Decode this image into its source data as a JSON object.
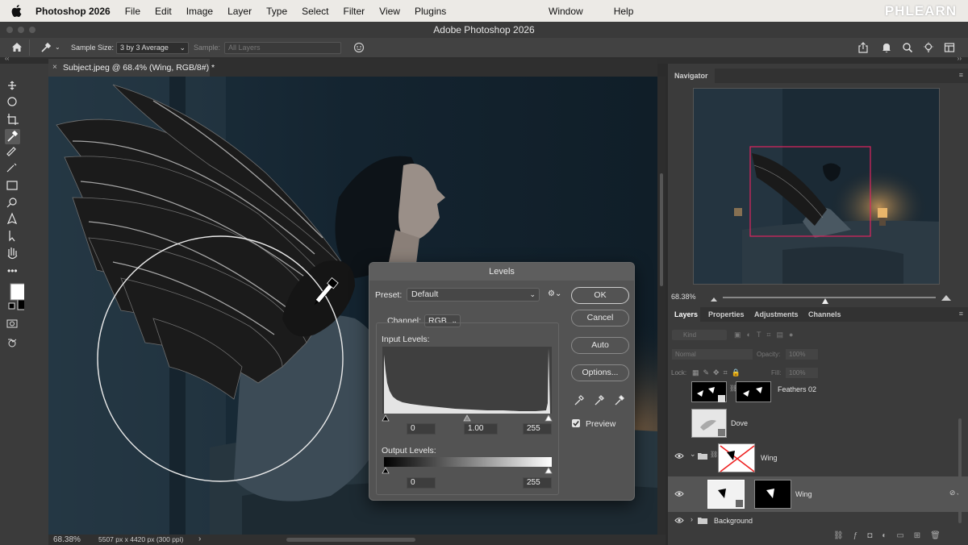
{
  "menubar": {
    "app_name": "Photoshop 2026",
    "items": [
      "File",
      "Edit",
      "Image",
      "Layer",
      "Type",
      "Select",
      "Filter",
      "View",
      "Plugins"
    ],
    "right_items": [
      "Window",
      "Help"
    ],
    "watermark": "PHLEARN"
  },
  "window": {
    "title": "Adobe Photoshop 2026"
  },
  "options": {
    "sample_size_label": "Sample Size:",
    "sample_size_value": "3 by 3 Average",
    "sample_label": "Sample:",
    "sample_value": "All Layers"
  },
  "document": {
    "tab_title": "Subject.jpeg @ 68.4% (Wing, RGB/8#) *",
    "zoom": "68.38%",
    "dimensions": "5507 px x 4420 px (300 ppi)"
  },
  "navigator": {
    "title": "Navigator",
    "zoom": "68.38%",
    "zoom_level": 0.48
  },
  "panel_tabs": [
    "Layers",
    "Properties",
    "Adjustments",
    "Channels"
  ],
  "layers_panel": {
    "kind_placeholder": "Kind",
    "blend_mode": "Normal",
    "opacity_label": "Opacity:",
    "opacity_value": "100%",
    "lock_label": "Lock:",
    "fill_label": "Fill:",
    "fill_value": "100%",
    "layers": [
      {
        "name": "Feathers 02",
        "visible": false
      },
      {
        "name": "Dove",
        "visible": false
      },
      {
        "name": "Wing",
        "visible": true,
        "type": "group"
      },
      {
        "name": "Wing",
        "visible": true,
        "selected": true
      },
      {
        "name": "Background",
        "visible": true,
        "type": "group"
      }
    ]
  },
  "levels": {
    "title": "Levels",
    "preset_label": "Preset:",
    "preset_value": "Default",
    "channel_label": "Channel:",
    "channel_value": "RGB",
    "input_levels_label": "Input Levels:",
    "input_black": "0",
    "input_gamma": "1.00",
    "input_white": "255",
    "output_levels_label": "Output Levels:",
    "output_black": "0",
    "output_white": "255",
    "buttons": {
      "ok": "OK",
      "cancel": "Cancel",
      "auto": "Auto",
      "options": "Options..."
    },
    "preview_label": "Preview",
    "preview_checked": true
  },
  "colors": {
    "accent": "#1473e6",
    "selection": "#555555",
    "nav_box": "#e0245e"
  }
}
